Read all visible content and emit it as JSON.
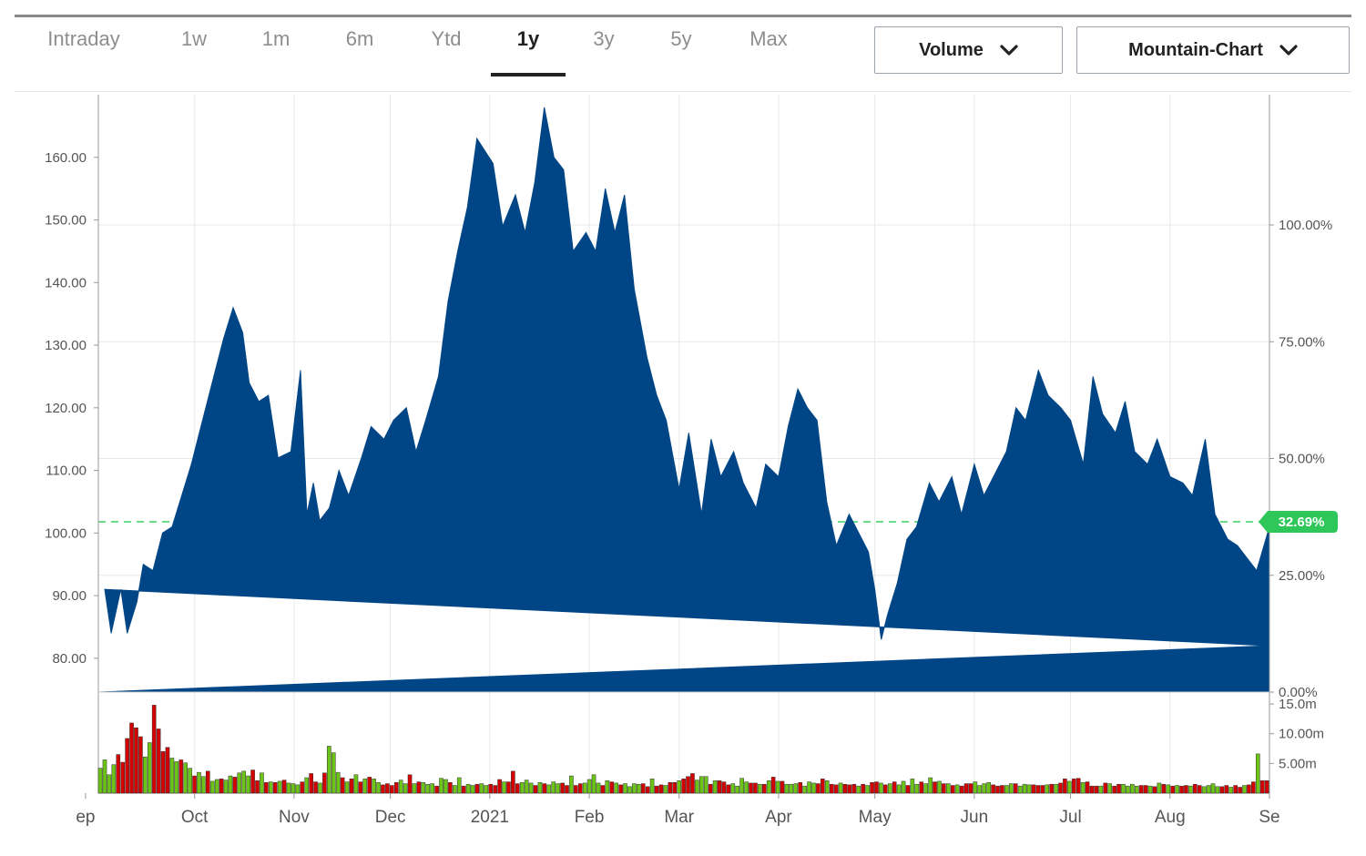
{
  "tabs": [
    {
      "label": "Intraday",
      "active": false
    },
    {
      "label": "1w",
      "active": false
    },
    {
      "label": "1m",
      "active": false
    },
    {
      "label": "6m",
      "active": false
    },
    {
      "label": "Ytd",
      "active": false
    },
    {
      "label": "1y",
      "active": true
    },
    {
      "label": "3y",
      "active": false
    },
    {
      "label": "5y",
      "active": false
    },
    {
      "label": "Max",
      "active": false
    }
  ],
  "controls": {
    "volume_label": "Volume",
    "chart_type_label": "Mountain-Chart",
    "chevron_icon": "chevron-down-icon"
  },
  "colors": {
    "area": "#004686",
    "volume_up": "#6cc417",
    "volume_down": "#d40000",
    "reference_line": "#6ddc8a",
    "badge": "#2fc75a",
    "grid": "#e8e8e8"
  },
  "chart_data": [
    {
      "type": "area",
      "title": "",
      "xlabel": "",
      "ylabel": "",
      "x_ticks": [
        "ep",
        "Oct",
        "Nov",
        "Dec",
        "2021",
        "Feb",
        "Mar",
        "Apr",
        "May",
        "Jun",
        "Jul",
        "Aug",
        "Se"
      ],
      "y_ticks_left": [
        "80.00",
        "90.00",
        "100.00",
        "110.00",
        "120.00",
        "130.00",
        "140.00",
        "150.00",
        "160.00"
      ],
      "y_ticks_right": [
        "0.00%",
        "25.00%",
        "50.00%",
        "75.00%",
        "100.00%"
      ],
      "ylim": [
        74.6,
        170
      ],
      "reference_value": 101.8,
      "last_change_label": "32.69%",
      "grid": true,
      "series": [
        {
          "x": [
            "Sep 1",
            "Sep 3",
            "Sep 5",
            "Sep 8",
            "Sep 10",
            "Sep 13",
            "Sep 15",
            "Sep 18",
            "Sep 21",
            "Sep 24",
            "Sep 27",
            "Sep 30",
            "Oct 3",
            "Oct 7",
            "Oct 10",
            "Oct 13",
            "Oct 16",
            "Oct 18",
            "Oct 21",
            "Oct 24",
            "Oct 27",
            "Oct 31",
            "Nov 3",
            "Nov 5",
            "Nov 7",
            "Nov 9",
            "Nov 12",
            "Nov 15",
            "Nov 18",
            "Nov 22",
            "Nov 25",
            "Nov 29",
            "Dec 2",
            "Dec 6",
            "Dec 9",
            "Dec 12",
            "Dec 16",
            "Dec 19",
            "Dec 22",
            "Dec 25",
            "Dec 28",
            "Jan 2",
            "Jan 5",
            "Jan 9",
            "Jan 12",
            "Jan 15",
            "Jan 18",
            "Jan 21",
            "Jan 24",
            "Jan 27",
            "Jan 31",
            "Feb 3",
            "Feb 6",
            "Feb 9",
            "Feb 12",
            "Feb 15",
            "Feb 19",
            "Feb 22",
            "Feb 25",
            "Mar 1",
            "Mar 4",
            "Mar 8",
            "Mar 11",
            "Mar 14",
            "Mar 18",
            "Mar 21",
            "Mar 25",
            "Mar 28",
            "Apr 1",
            "Apr 4",
            "Apr 7",
            "Apr 10",
            "Apr 13",
            "Apr 16",
            "Apr 19",
            "Apr 23",
            "Apr 26",
            "Apr 29",
            "May 1",
            "May 3",
            "May 5",
            "May 8",
            "May 11",
            "May 14",
            "May 18",
            "May 21",
            "May 25",
            "May 28",
            "Jun 1",
            "Jun 4",
            "Jun 8",
            "Jun 11",
            "Jun 14",
            "Jun 17",
            "Jun 21",
            "Jun 24",
            "Jun 28",
            "Jul 1",
            "Jul 5",
            "Jul 8",
            "Jul 11",
            "Jul 15",
            "Jul 18",
            "Jul 21",
            "Jul 25",
            "Jul 28",
            "Aug 1",
            "Aug 5",
            "Aug 8",
            "Aug 12",
            "Aug 15",
            "Aug 19",
            "Aug 22",
            "Aug 25",
            "Aug 28",
            "Sep 1"
          ],
          "values": [
            82,
            91,
            84,
            91,
            84,
            89,
            95,
            94,
            100,
            101,
            106,
            111,
            117,
            125,
            131,
            136,
            132,
            124,
            121,
            122,
            112,
            113,
            126,
            103,
            108,
            102,
            104,
            110,
            106,
            112,
            117,
            115,
            118,
            120,
            113,
            118,
            125,
            137,
            145,
            152,
            163,
            159,
            149,
            154,
            148,
            156,
            168,
            160,
            158,
            145,
            148,
            145,
            155,
            148,
            154,
            139,
            128,
            122,
            118,
            107,
            116,
            103,
            115,
            109,
            113,
            108,
            104,
            111,
            109,
            117,
            123,
            120,
            118,
            105,
            98,
            103,
            100,
            97,
            91,
            83,
            87,
            92,
            99,
            101,
            108,
            105,
            109,
            103,
            111,
            106,
            110,
            113,
            120,
            118,
            126,
            122,
            120,
            118,
            111,
            125,
            119,
            116,
            121,
            113,
            111,
            115,
            109,
            108,
            106,
            115,
            103,
            99,
            98,
            96,
            94,
            101
          ]
        }
      ]
    },
    {
      "type": "bar",
      "title": "",
      "y_ticks": [
        "5.00m",
        "10.00m",
        "15.0m"
      ],
      "ylim": [
        0,
        17
      ],
      "series": [
        {
          "name": "",
          "values": [
            4.2,
            5.6,
            3.1,
            4.8,
            6.5,
            5.2,
            9.2,
            11.8,
            11,
            9.5,
            6.1,
            8.5,
            14.8,
            10.8,
            7,
            7.7,
            5.9,
            5.3,
            5.6,
            5.1,
            4.2,
            2.9,
            3.5,
            2.8,
            3.7,
            2,
            2.3,
            2.4,
            2.2,
            2.9,
            2.7,
            3.4,
            3.7,
            2.9,
            3.9,
            2.1,
            3.4,
            1.8,
            1.9,
            1.8,
            2,
            2.2,
            1.7,
            1.6,
            1.4,
            1.9,
            2.6,
            3.3,
            1.9,
            1.7,
            3.4,
            7.9,
            6.8,
            3.5,
            2.6,
            1.9,
            2.4,
            3.1,
            1.9,
            2.4,
            2.7,
            2.4,
            1.8,
            1.4,
            1.6,
            1.3,
            1.8,
            2.2,
            1.6,
            3.1,
            1.6,
            1.9,
            1.8,
            1.5,
            1.6,
            1.2,
            2.5,
            2.3,
            1.8,
            1.3,
            2.6,
            1.2,
            1.5,
            1.3,
            1.5,
            1.6,
            1.3,
            1.5,
            1.3,
            2.3,
            1.9,
            1.9,
            3.7,
            1.6,
            1.8,
            2.2,
            1.7,
            1.3,
            1.8,
            1.6,
            1.4,
            1.9,
            1.6,
            1.7,
            1.3,
            2.9,
            1.3,
            1.6,
            1.7,
            2.3,
            3.1,
            1.7,
            1.3,
            2.1,
            1.9,
            1.7,
            1.4,
            1.6,
            1.1,
            1.6,
            1.5,
            1.6,
            1.1,
            2.4,
            1.2,
            1.4,
            1.3,
            1.8,
            1.8,
            2.1,
            2.4,
            2.8,
            3.3,
            2.2,
            2.8,
            2.8,
            1.5,
            2.1,
            2.1,
            1.9,
            1.4,
            1.6,
            1.2,
            2.5,
            1.9,
            1.7,
            1.7,
            1.5,
            1.5,
            2.1,
            2.7,
            2,
            2,
            1.5,
            1.5,
            1.6,
            1.8,
            1.2,
            1.9,
            1.7,
            1.6,
            2.4,
            2.1,
            1.5,
            1.4,
            1.7,
            1.5,
            1.4,
            1.5,
            1.2,
            1.5,
            1.3,
            1.8,
            1.9,
            1.7,
            1.4,
            1.6,
            1.9,
            1.4,
            2,
            1.3,
            2.4,
            1.5,
            1.9,
            1.6,
            2.6,
            1.9,
            2,
            1.6,
            1.6,
            1.3,
            1.4,
            1.2,
            1.6,
            1.6,
            1.9,
            1.3,
            1.6,
            1.8,
            1.4,
            1.2,
            1.3,
            1.3,
            1.6,
            1.6,
            1.2,
            1.5,
            1.4,
            1.4,
            1.3,
            1.3,
            1.4,
            1.5,
            1.5,
            1.7,
            2.4,
            2,
            2.4,
            2.5,
            1.8,
            1.9,
            1.2,
            1.2,
            1.2,
            1.7,
            1.6,
            1.2,
            1.5,
            1.5,
            1.2,
            1.5,
            1.2,
            1.3,
            1.3,
            1.2,
            1.1,
            1.7,
            1.5,
            1.4,
            1.2,
            1.3,
            1.2,
            1.3,
            1.2,
            1.5,
            1.3,
            1.1,
            1.3,
            1.6,
            1.1,
            1.1,
            1.3,
            1,
            1.3,
            1,
            1.3,
            1.4,
            1.9,
            6.6,
            2.1,
            2.1
          ]
        }
      ]
    }
  ]
}
